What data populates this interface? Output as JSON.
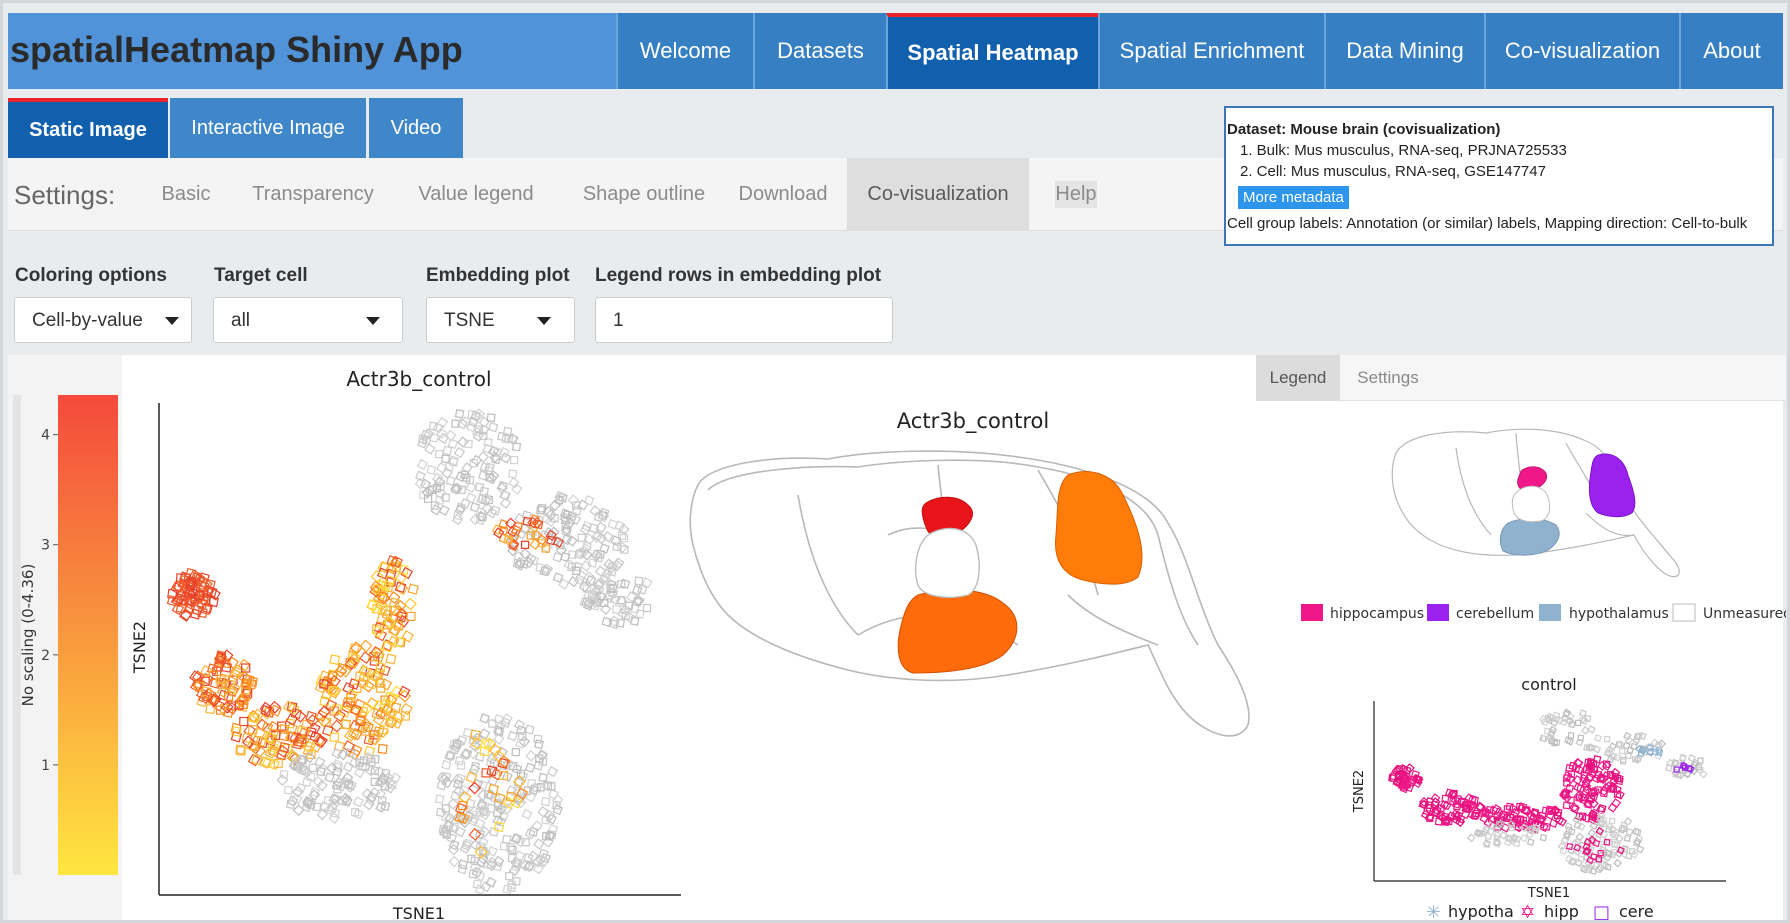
{
  "app": {
    "title": "spatialHeatmap Shiny App"
  },
  "nav": {
    "tabs": [
      {
        "label": "Welcome"
      },
      {
        "label": "Datasets"
      },
      {
        "label": "Spatial Heatmap"
      },
      {
        "label": "Spatial Enrichment"
      },
      {
        "label": "Data Mining"
      },
      {
        "label": "Co-visualization"
      },
      {
        "label": "About"
      }
    ],
    "active": "Spatial Heatmap"
  },
  "subtabs": [
    {
      "label": "Static Image"
    },
    {
      "label": "Interactive Image"
    },
    {
      "label": "Video"
    }
  ],
  "settings": {
    "label": "Settings:",
    "tabs": [
      {
        "label": "Basic"
      },
      {
        "label": "Transparency"
      },
      {
        "label": "Value legend"
      },
      {
        "label": "Shape outline"
      },
      {
        "label": "Download"
      },
      {
        "label": "Co-visualization"
      },
      {
        "label": "Help"
      }
    ],
    "active": "Co-visualization"
  },
  "dataset": {
    "title": "Dataset: Mouse brain (covisualization)",
    "line1": "1. Bulk: Mus musculus, RNA-seq, PRJNA725533",
    "line2": "2. Cell: Mus musculus, RNA-seq, GSE147747",
    "more_button": "More metadata",
    "labels": "Cell group labels: Annotation (or similar) labels, Mapping direction: Cell-to-bulk"
  },
  "controls": {
    "coloring": {
      "label": "Coloring options",
      "value": "Cell-by-value"
    },
    "target": {
      "label": "Target cell",
      "value": "all"
    },
    "embedding": {
      "label": "Embedding plot",
      "value": "TSNE"
    },
    "legend_rows": {
      "label": "Legend rows in embedding plot",
      "value": "1"
    }
  },
  "colorbar": {
    "label": "No scaling (0-4.36)",
    "ticks": [
      "4",
      "3",
      "2",
      "1"
    ],
    "min": 0,
    "max": 4.36,
    "colors": {
      "high": "#f44a3c",
      "low": "#ffe640"
    }
  },
  "embedding_plot": {
    "title": "Actr3b_control",
    "xlabel": "TSNE1",
    "ylabel": "TSNE2"
  },
  "brain_plot": {
    "title": "Actr3b_control",
    "colors": {
      "hippocampus": "#e8141a",
      "cerebellum": "#ff7c0a",
      "hypothalamus": "#ff6a0a"
    }
  },
  "legend_panel": {
    "tabs": [
      {
        "label": "Legend"
      },
      {
        "label": "Settings"
      }
    ],
    "active": "Legend",
    "items": [
      {
        "label": "hippocampus",
        "color": "#f01889"
      },
      {
        "label": "cerebellum",
        "color": "#9b22ee"
      },
      {
        "label": "hypothalamus",
        "color": "#8fb2cf"
      },
      {
        "label": "Unmeasured",
        "color": "#ffffff"
      }
    ],
    "mini_plot": {
      "title": "control",
      "xlabel": "TSNE1",
      "ylabel": "TSNE2"
    },
    "mini_legend": [
      {
        "label": "hypotha",
        "symbol": "✳",
        "color": "#8fb2cf"
      },
      {
        "label": "hipp",
        "symbol": "✡",
        "color": "#f01889"
      },
      {
        "label": "cere",
        "symbol": "□",
        "color": "#9b22ee"
      }
    ]
  }
}
